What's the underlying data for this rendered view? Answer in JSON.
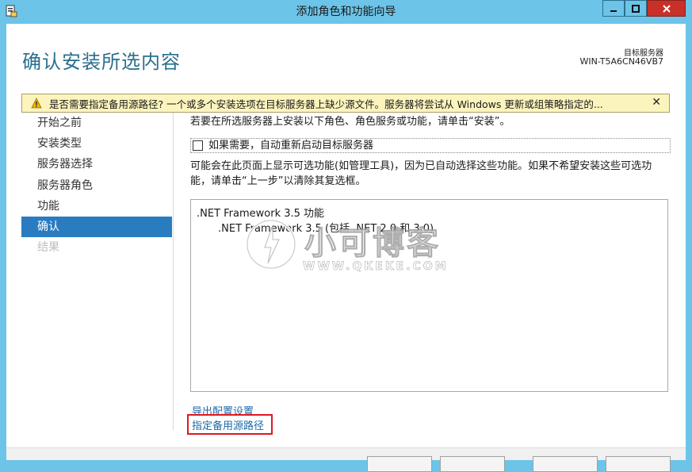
{
  "window": {
    "title": "添加角色和功能向导"
  },
  "header": {
    "page_title": "确认安装所选内容",
    "dest_label": "目标服务器",
    "dest_name": "WIN-T5A6CN46VB7"
  },
  "warning": {
    "text": "是否需要指定备用源路径? 一个或多个安装选项在目标服务器上缺少源文件。服务器将尝试从 Windows 更新或组策略指定的...",
    "close_glyph": "✕"
  },
  "nav": {
    "items": [
      {
        "label": "开始之前"
      },
      {
        "label": "安装类型"
      },
      {
        "label": "服务器选择"
      },
      {
        "label": "服务器角色"
      },
      {
        "label": "功能"
      },
      {
        "label": "确认"
      },
      {
        "label": "结果"
      }
    ]
  },
  "main": {
    "intro": "若要在所选服务器上安装以下角色、角色服务或功能，请单击“安装”。",
    "restart_label": "如果需要，自动重新启动目标服务器",
    "info_line1": "可能会在此页面上显示可选功能(如管理工具)，因为已自动选择这些功能。如果不希望安装这些可选功",
    "info_line2": "能，请单击“上一步”以清除其复选框。",
    "features": [
      ".NET Framework 3.5 功能",
      ".NET Framework 3.5 (包括 .NET 2.0 和 3.0)"
    ],
    "links": {
      "export": "导出配置设置",
      "source": "指定备用源路径"
    }
  },
  "watermark": {
    "title": "小可博客",
    "sub": "WWW.QKEKE.COM"
  },
  "colors": {
    "title_bar": "#6cc4e8",
    "accent_title": "#2a6f8e",
    "nav_active": "#2a7cc0",
    "warning_bg": "#fcf4bd",
    "highlight_box": "#e0181e",
    "link": "#1a6aa8"
  }
}
